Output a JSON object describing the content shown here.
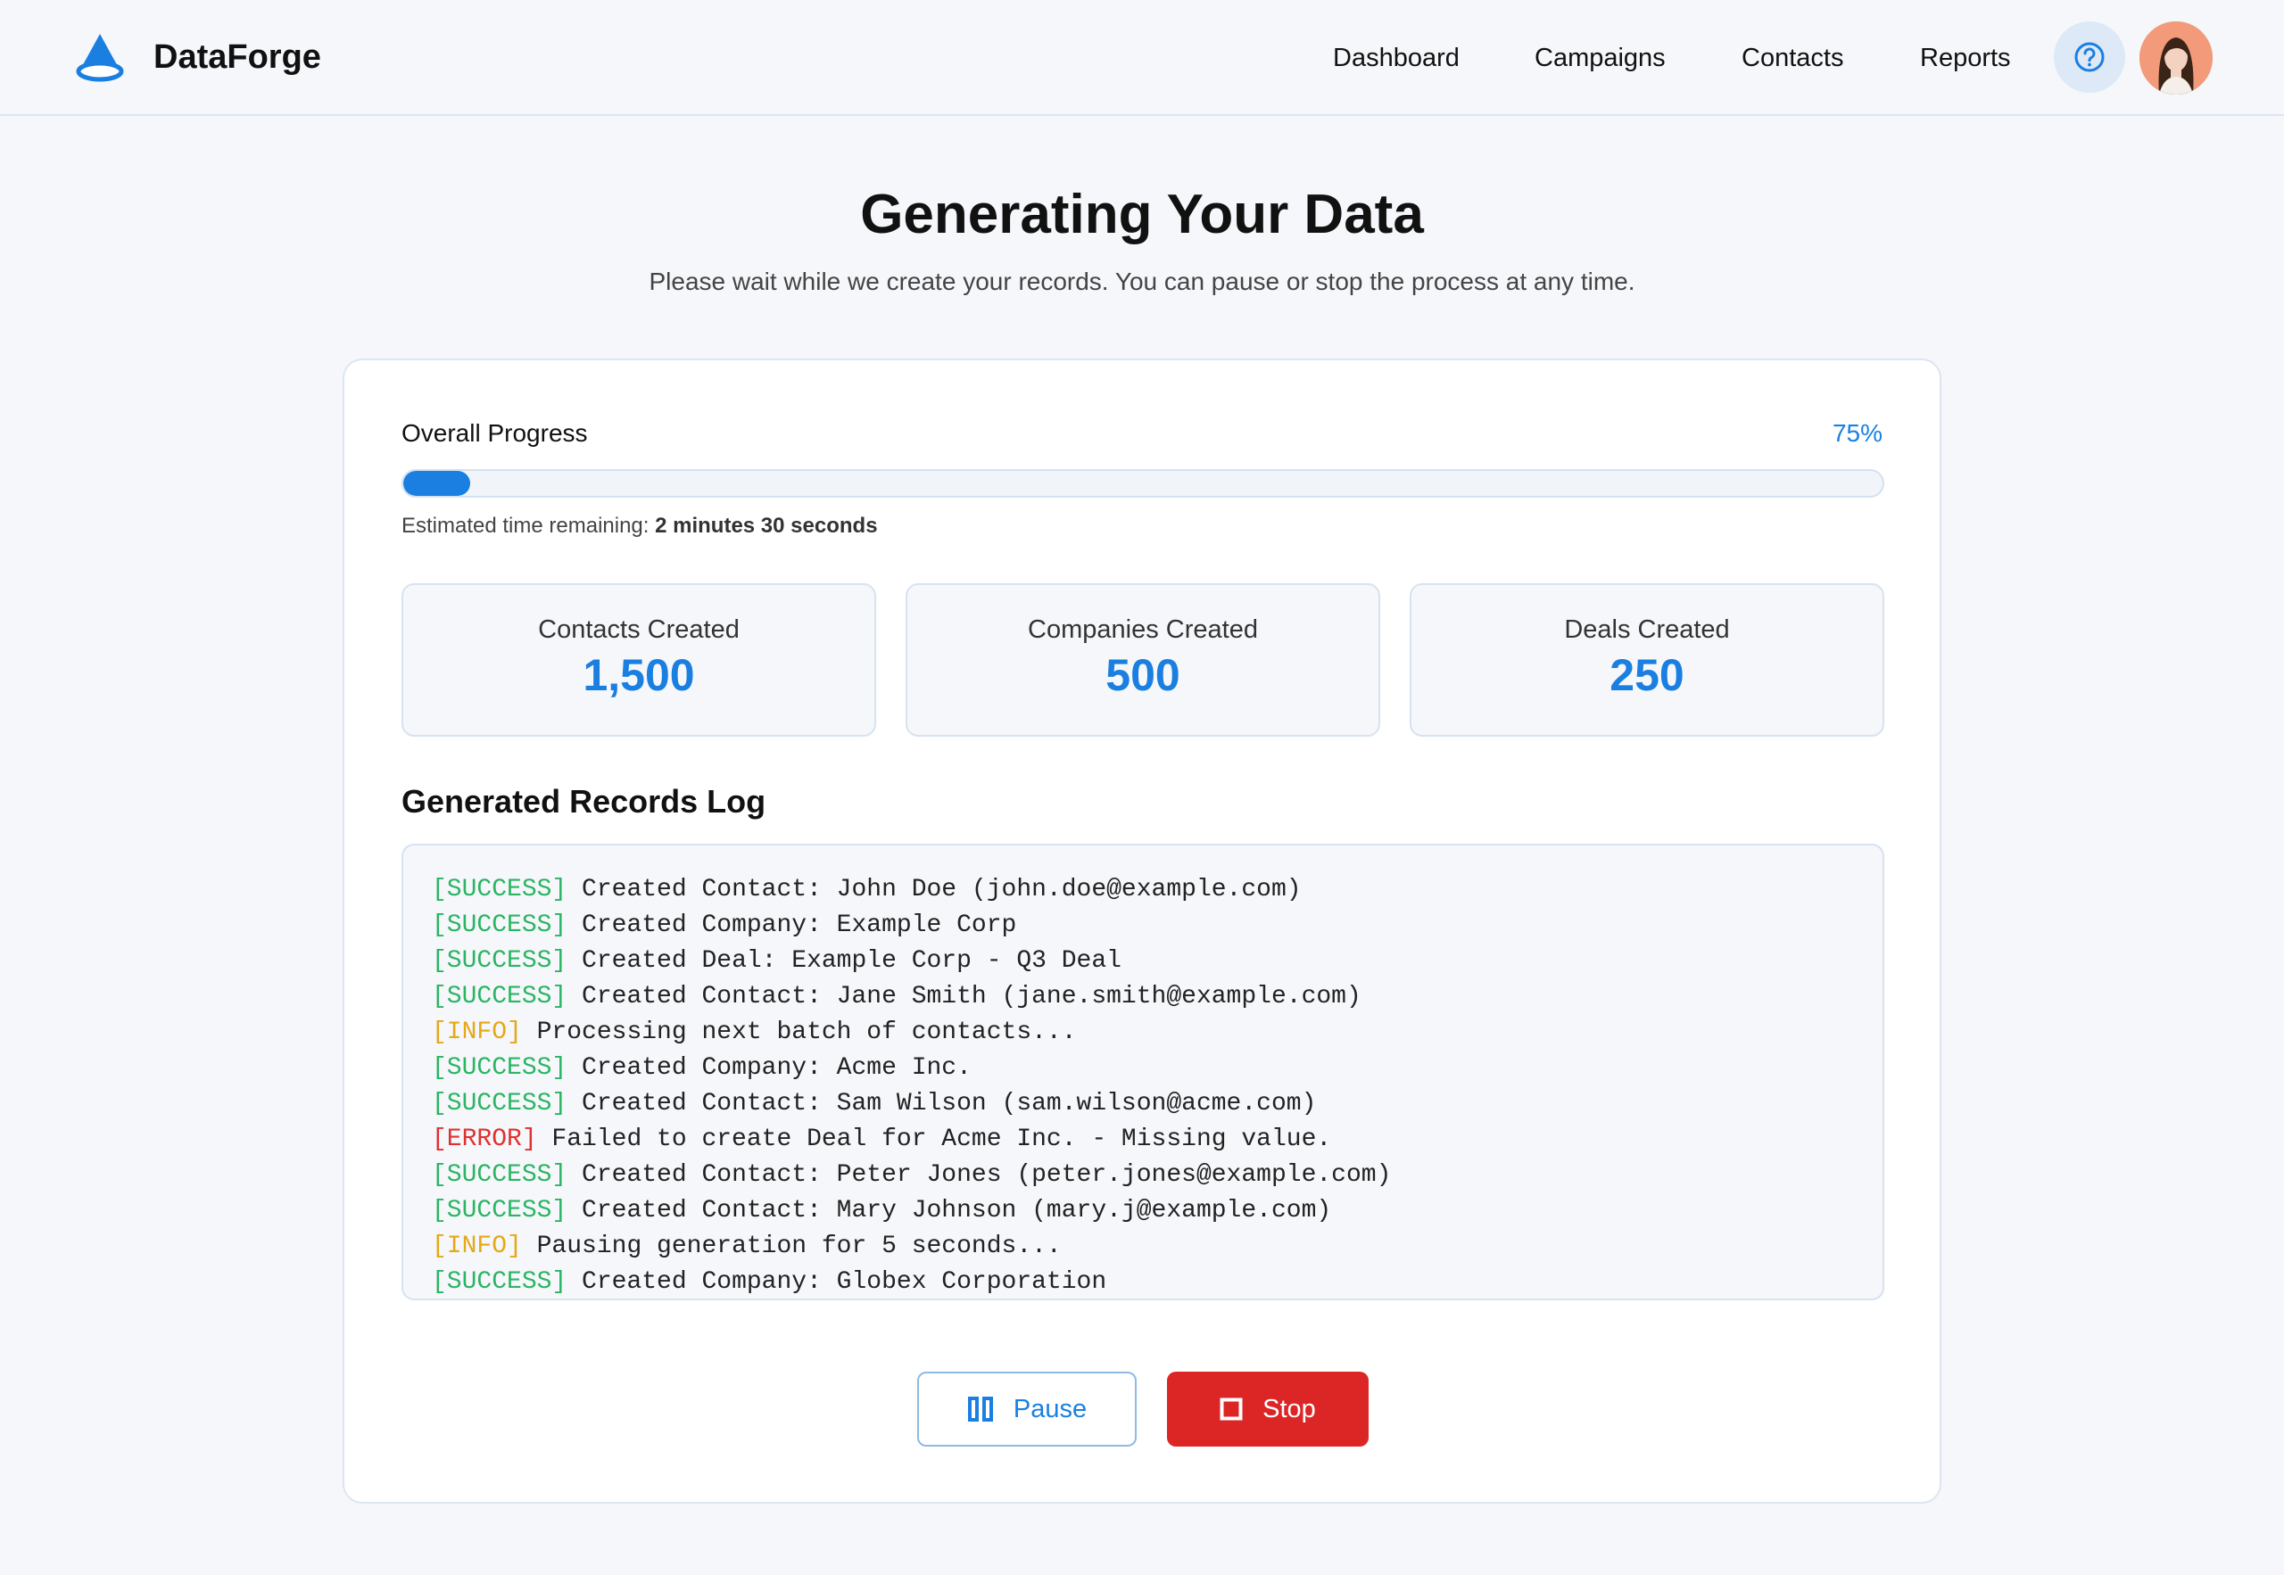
{
  "header": {
    "brand": "DataForge",
    "nav": [
      {
        "label": "Dashboard"
      },
      {
        "label": "Campaigns"
      },
      {
        "label": "Contacts"
      },
      {
        "label": "Reports"
      }
    ],
    "help_icon": "help-circle-icon",
    "avatar_icon": "user-avatar"
  },
  "main": {
    "title": "Generating Your Data",
    "subtitle": "Please wait while we create your records. You can pause or stop the process at any time."
  },
  "progress": {
    "label": "Overall Progress",
    "percent_text": "75%",
    "bar_fill_fraction": 0.045,
    "eta_prefix": "Estimated time remaining: ",
    "eta_value": "2 minutes 30 seconds"
  },
  "stats": [
    {
      "label": "Contacts Created",
      "value": "1,500"
    },
    {
      "label": "Companies Created",
      "value": "500"
    },
    {
      "label": "Deals Created",
      "value": "250"
    }
  ],
  "log": {
    "title": "Generated Records Log",
    "entries": [
      {
        "level": "success",
        "tag": "[SUCCESS]",
        "text": " Created Contact: John Doe (john.doe@example.com)"
      },
      {
        "level": "success",
        "tag": "[SUCCESS]",
        "text": " Created Company: Example Corp"
      },
      {
        "level": "success",
        "tag": "[SUCCESS]",
        "text": " Created Deal: Example Corp - Q3 Deal"
      },
      {
        "level": "success",
        "tag": "[SUCCESS]",
        "text": " Created Contact: Jane Smith (jane.smith@example.com)"
      },
      {
        "level": "info",
        "tag": "[INFO]",
        "text": " Processing next batch of contacts..."
      },
      {
        "level": "success",
        "tag": "[SUCCESS]",
        "text": " Created Company: Acme Inc."
      },
      {
        "level": "success",
        "tag": "[SUCCESS]",
        "text": " Created Contact: Sam Wilson (sam.wilson@acme.com)"
      },
      {
        "level": "error",
        "tag": "[ERROR]",
        "text": " Failed to create Deal for Acme Inc. - Missing value."
      },
      {
        "level": "success",
        "tag": "[SUCCESS]",
        "text": " Created Contact: Peter Jones (peter.jones@example.com)"
      },
      {
        "level": "success",
        "tag": "[SUCCESS]",
        "text": " Created Contact: Mary Johnson (mary.j@example.com)"
      },
      {
        "level": "info",
        "tag": "[INFO]",
        "text": " Pausing generation for 5 seconds..."
      },
      {
        "level": "success",
        "tag": "[SUCCESS]",
        "text": " Created Company: Globex Corporation"
      }
    ]
  },
  "actions": {
    "pause_label": "Pause",
    "pause_icon": "pause-icon",
    "stop_label": "Stop",
    "stop_icon": "stop-icon"
  },
  "colors": {
    "accent": "#1a7fe0",
    "success": "#2bb463",
    "info": "#e6a817",
    "error": "#e03131",
    "stop": "#dc2626"
  }
}
